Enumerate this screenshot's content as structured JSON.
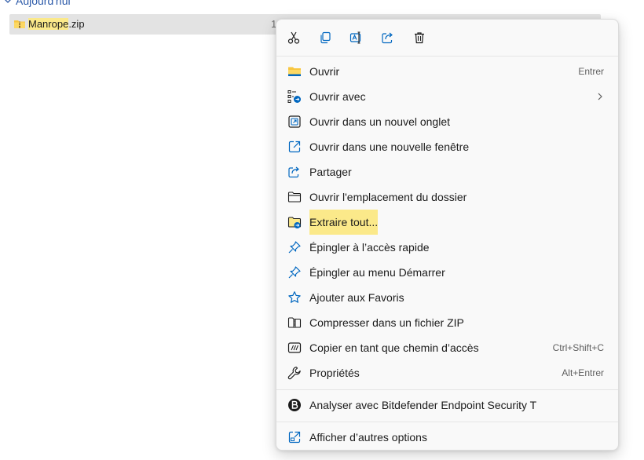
{
  "group": {
    "title": "Aujourd'hui"
  },
  "file": {
    "name_main": "Manrope",
    "name_ext": ".zip",
    "extra": "1"
  },
  "quick_actions": [
    {
      "name": "cut",
      "icon": "scissors-icon"
    },
    {
      "name": "copy",
      "icon": "copy-icon"
    },
    {
      "name": "rename",
      "icon": "rename-icon"
    },
    {
      "name": "share",
      "icon": "share-icon"
    },
    {
      "name": "delete",
      "icon": "trash-icon"
    }
  ],
  "menu": {
    "open": {
      "label": "Ouvrir",
      "shortcut": "Entrer"
    },
    "open_with": {
      "label": "Ouvrir avec"
    },
    "open_new_tab": {
      "label": "Ouvrir dans un nouvel onglet"
    },
    "open_new_window": {
      "label": "Ouvrir dans une nouvelle fenêtre"
    },
    "share": {
      "label": "Partager"
    },
    "open_location": {
      "label": "Ouvrir l'emplacement du dossier"
    },
    "extract_all": {
      "label": "Extraire tout..."
    },
    "pin_quick_access": {
      "label": "Épingler à l’accès rapide"
    },
    "pin_start": {
      "label": "Épingler au menu Démarrer"
    },
    "add_favorites": {
      "label": "Ajouter aux Favoris"
    },
    "compress_zip": {
      "label": "Compresser dans un fichier ZIP"
    },
    "copy_path": {
      "label": "Copier en tant que chemin d’accès",
      "shortcut": "Ctrl+Shift+C"
    },
    "properties": {
      "label": "Propriétés",
      "shortcut": "Alt+Entrer"
    },
    "bitdefender": {
      "label": "Analyser avec Bitdefender Endpoint Security T"
    },
    "more_options": {
      "label": "Afficher d’autres options"
    }
  },
  "colors": {
    "accent": "#0067c0",
    "highlight": "#fbe98a",
    "folder": "#f8c640",
    "selection": "#e3e3e3"
  }
}
